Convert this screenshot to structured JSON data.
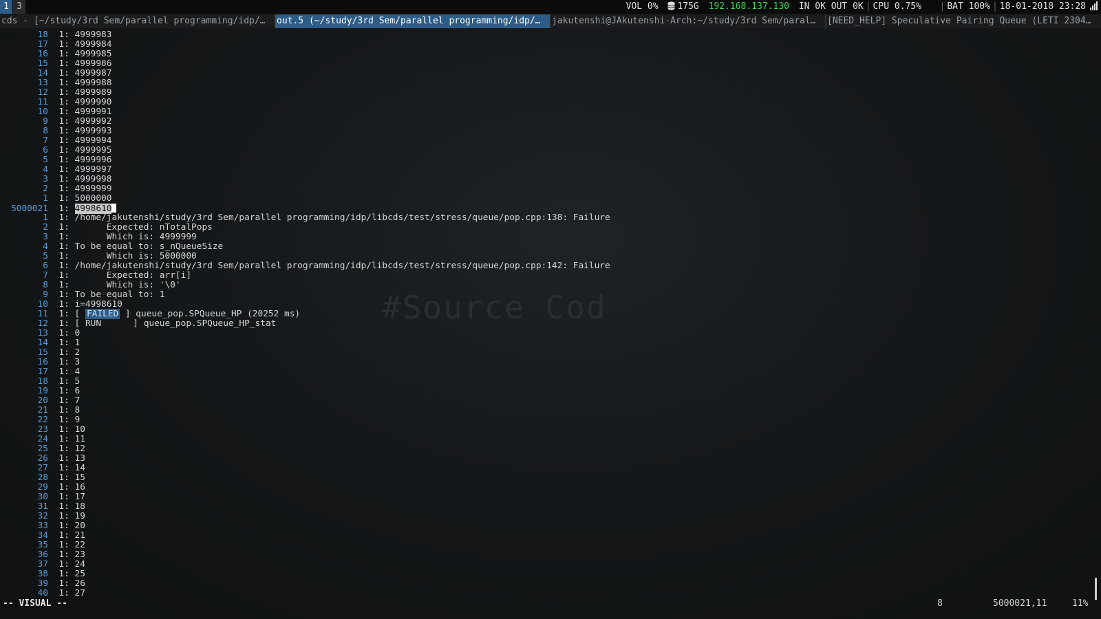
{
  "workspaces": [
    "1",
    "3"
  ],
  "status": {
    "vol": "VOL 0%",
    "disk": "175G",
    "ip": "192.168.137.130",
    "net": "IN 0K OUT 0K",
    "cpu": "CPU 0.75%",
    "bat": "BAT 100%",
    "datetime": "18-01-2018 23:28"
  },
  "tabs": [
    "cds - [~/study/3rd Sem/parallel programming/idp/…",
    "out.5 (~/study/3rd Sem/parallel programming/idp/…",
    "jakutenshi@JAkutenshi-Arch:~/study/3rd Sem/paral…",
    "[NEED_HELP] Speculative Pairing Queue (LETI 2304…"
  ],
  "active_tab": 1,
  "watermark": "#Source Cod",
  "lines": [
    {
      "n": "18",
      "t": "1: 4999983"
    },
    {
      "n": "17",
      "t": "1: 4999984"
    },
    {
      "n": "16",
      "t": "1: 4999985"
    },
    {
      "n": "15",
      "t": "1: 4999986"
    },
    {
      "n": "14",
      "t": "1: 4999987"
    },
    {
      "n": "13",
      "t": "1: 4999988"
    },
    {
      "n": "12",
      "t": "1: 4999989"
    },
    {
      "n": "11",
      "t": "1: 4999990"
    },
    {
      "n": "10",
      "t": "1: 4999991"
    },
    {
      "n": "9",
      "t": "1: 4999992"
    },
    {
      "n": "8",
      "t": "1: 4999993"
    },
    {
      "n": "7",
      "t": "1: 4999994"
    },
    {
      "n": "6",
      "t": "1: 4999995"
    },
    {
      "n": "5",
      "t": "1: 4999996"
    },
    {
      "n": "4",
      "t": "1: 4999997"
    },
    {
      "n": "3",
      "t": "1: 4999998"
    },
    {
      "n": "2",
      "t": "1: 4999999"
    },
    {
      "n": "1",
      "t": "1: 5000000"
    },
    {
      "n": "5000021",
      "t": "1: ",
      "sel": "4998610",
      "current": true
    },
    {
      "n": "1",
      "t": "1: /home/jakutenshi/study/3rd Sem/parallel programming/idp/libcds/test/stress/queue/pop.cpp:138: Failure"
    },
    {
      "n": "2",
      "t": "1:       Expected: nTotalPops"
    },
    {
      "n": "3",
      "t": "1:       Which is: 4999999"
    },
    {
      "n": "4",
      "t": "1: To be equal to: s_nQueueSize"
    },
    {
      "n": "5",
      "t": "1:       Which is: 5000000"
    },
    {
      "n": "6",
      "t": "1: /home/jakutenshi/study/3rd Sem/parallel programming/idp/libcds/test/stress/queue/pop.cpp:142: Failure"
    },
    {
      "n": "7",
      "t": "1:       Expected: arr[i]"
    },
    {
      "n": "8",
      "t": "1:       Which is: '\\0'"
    },
    {
      "n": "9",
      "t": "1: To be equal to: 1"
    },
    {
      "n": "10",
      "t": "1: i=4998610"
    },
    {
      "n": "11",
      "t": "1: [ ",
      "tag": "FAILED",
      "tail": " ] queue_pop.SPQueue_HP (20252 ms)"
    },
    {
      "n": "12",
      "t": "1: [ RUN      ] queue_pop.SPQueue_HP_stat"
    },
    {
      "n": "13",
      "t": "1: 0"
    },
    {
      "n": "14",
      "t": "1: 1"
    },
    {
      "n": "15",
      "t": "1: 2"
    },
    {
      "n": "16",
      "t": "1: 3"
    },
    {
      "n": "17",
      "t": "1: 4"
    },
    {
      "n": "18",
      "t": "1: 5"
    },
    {
      "n": "19",
      "t": "1: 6"
    },
    {
      "n": "20",
      "t": "1: 7"
    },
    {
      "n": "21",
      "t": "1: 8"
    },
    {
      "n": "22",
      "t": "1: 9"
    },
    {
      "n": "23",
      "t": "1: 10"
    },
    {
      "n": "24",
      "t": "1: 11"
    },
    {
      "n": "25",
      "t": "1: 12"
    },
    {
      "n": "26",
      "t": "1: 13"
    },
    {
      "n": "27",
      "t": "1: 14"
    },
    {
      "n": "28",
      "t": "1: 15"
    },
    {
      "n": "29",
      "t": "1: 16"
    },
    {
      "n": "30",
      "t": "1: 17"
    },
    {
      "n": "31",
      "t": "1: 18"
    },
    {
      "n": "32",
      "t": "1: 19"
    },
    {
      "n": "33",
      "t": "1: 20"
    },
    {
      "n": "34",
      "t": "1: 21"
    },
    {
      "n": "35",
      "t": "1: 22"
    },
    {
      "n": "36",
      "t": "1: 23"
    },
    {
      "n": "37",
      "t": "1: 24"
    },
    {
      "n": "38",
      "t": "1: 25"
    },
    {
      "n": "39",
      "t": "1: 26"
    },
    {
      "n": "40",
      "t": "1: 27"
    }
  ],
  "statusline": {
    "mode": "-- VISUAL --",
    "selection_count": "8",
    "position": "5000021,11",
    "percent": "11%"
  }
}
